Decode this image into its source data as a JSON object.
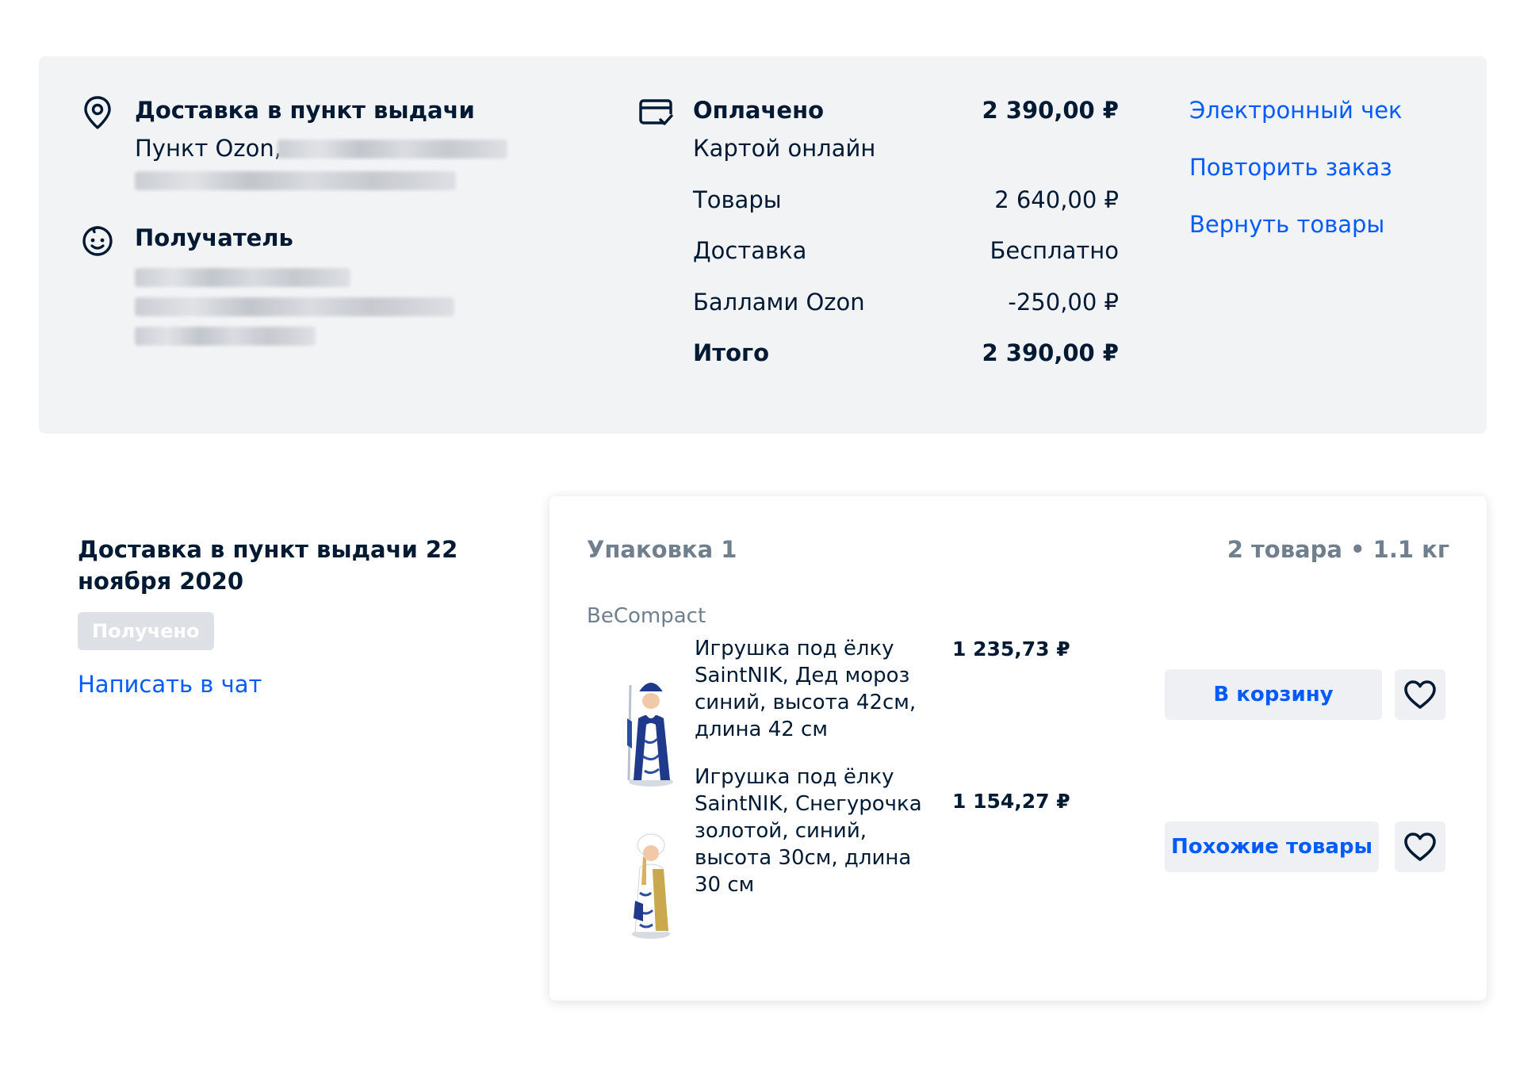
{
  "delivery": {
    "title": "Доставка в пункт выдачи",
    "address_prefix": "Пункт Ozon,"
  },
  "recipient": {
    "title": "Получатель"
  },
  "payment": {
    "title": "Оплачено",
    "total_top": "2 390,00 ₽",
    "method": "Картой онлайн",
    "rows": [
      {
        "label": "Товары",
        "value": "2 640,00 ₽"
      },
      {
        "label": "Доставка",
        "value": "Бесплатно"
      },
      {
        "label": "Баллами Ozon",
        "value": "-250,00 ₽"
      }
    ],
    "total_label": "Итого",
    "total_value": "2 390,00 ₽"
  },
  "actions": {
    "receipt": "Электронный чек",
    "repeat": "Повторить заказ",
    "return": "Вернуть товары"
  },
  "shipment": {
    "title_line1": "Доставка в пункт выдачи 22",
    "title_line2": "ноября 2020",
    "status": "Получено",
    "chat_link": "Написать в чат"
  },
  "package": {
    "title": "Упаковка 1",
    "summary": "2 товара • 1.1 кг",
    "seller": "BeCompact",
    "items": [
      {
        "name": "Игрушка под ёлку SaintNIK, Дед мороз синий, высота 42см, длина 42 см",
        "price": "1 235,73 ₽",
        "button": "В корзину"
      },
      {
        "name": "Игрушка под ёлку SaintNIK, Снегурочка золотой, синий, высота 30см, длина 30 см",
        "price": "1 154,27 ₽",
        "button": "Похожие товары"
      }
    ]
  },
  "colors": {
    "accent": "#005bff",
    "text": "#001a34",
    "muted": "#707f8d",
    "panel": "#f2f3f5"
  },
  "icons": [
    "location-pin-icon",
    "recipient-face-icon",
    "card-paid-icon",
    "heart-icon"
  ]
}
